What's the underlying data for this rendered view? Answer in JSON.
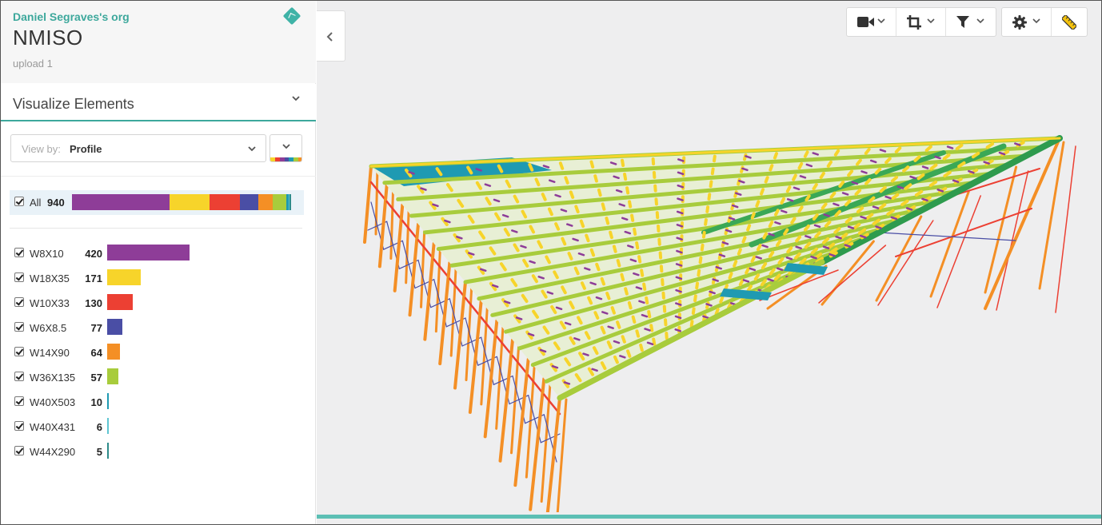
{
  "org": {
    "name": "Daniel Segraves's org",
    "logo_icon": "org-logo-icon"
  },
  "project": {
    "title": "NMISO",
    "subtitle": "upload 1"
  },
  "panel": {
    "title": "Visualize Elements",
    "collapse_icon": "chevron-down-icon"
  },
  "view_by": {
    "prefix": "View by:",
    "value": "Profile",
    "palette_icon": "color-palette-icon"
  },
  "all": {
    "label": "All",
    "count": "940",
    "checked": true
  },
  "profiles": [
    {
      "name": "W8X10",
      "count": "420",
      "value": 420,
      "color": "#8e3d98",
      "checked": true
    },
    {
      "name": "W18X35",
      "count": "171",
      "value": 171,
      "color": "#f7d42a",
      "checked": true
    },
    {
      "name": "W10X33",
      "count": "130",
      "value": 130,
      "color": "#ec4033",
      "checked": true
    },
    {
      "name": "W6X8.5",
      "count": "77",
      "value": 77,
      "color": "#4a4ea5",
      "checked": true
    },
    {
      "name": "W14X90",
      "count": "64",
      "value": 64,
      "color": "#f48f25",
      "checked": true
    },
    {
      "name": "W36X135",
      "count": "57",
      "value": 57,
      "color": "#a8cc3c",
      "checked": true
    },
    {
      "name": "W40X503",
      "count": "10",
      "value": 10,
      "color": "#1f9ab2",
      "checked": true
    },
    {
      "name": "W40X431",
      "count": "6",
      "value": 6,
      "color": "#5fc5d2",
      "checked": true
    },
    {
      "name": "W44X290",
      "count": "5",
      "value": 5,
      "color": "#2d8b8a",
      "checked": true
    }
  ],
  "palette_colors": [
    "#f7d42a",
    "#ec4033",
    "#8e3d98",
    "#4a4ea5",
    "#1f9ab2",
    "#a8cc3c",
    "#f48f25"
  ],
  "viewer": {
    "collapse_icon": "chevron-left-icon",
    "toolbar": [
      {
        "icon": "camera-icon",
        "has_dropdown": true
      },
      {
        "icon": "crop-icon",
        "has_dropdown": true
      },
      {
        "icon": "filter-icon",
        "has_dropdown": true
      },
      {
        "icon": "gear-icon",
        "has_dropdown": true
      },
      {
        "icon": "ruler-icon",
        "has_dropdown": false
      }
    ],
    "accent_color": "#5cbfb4"
  }
}
